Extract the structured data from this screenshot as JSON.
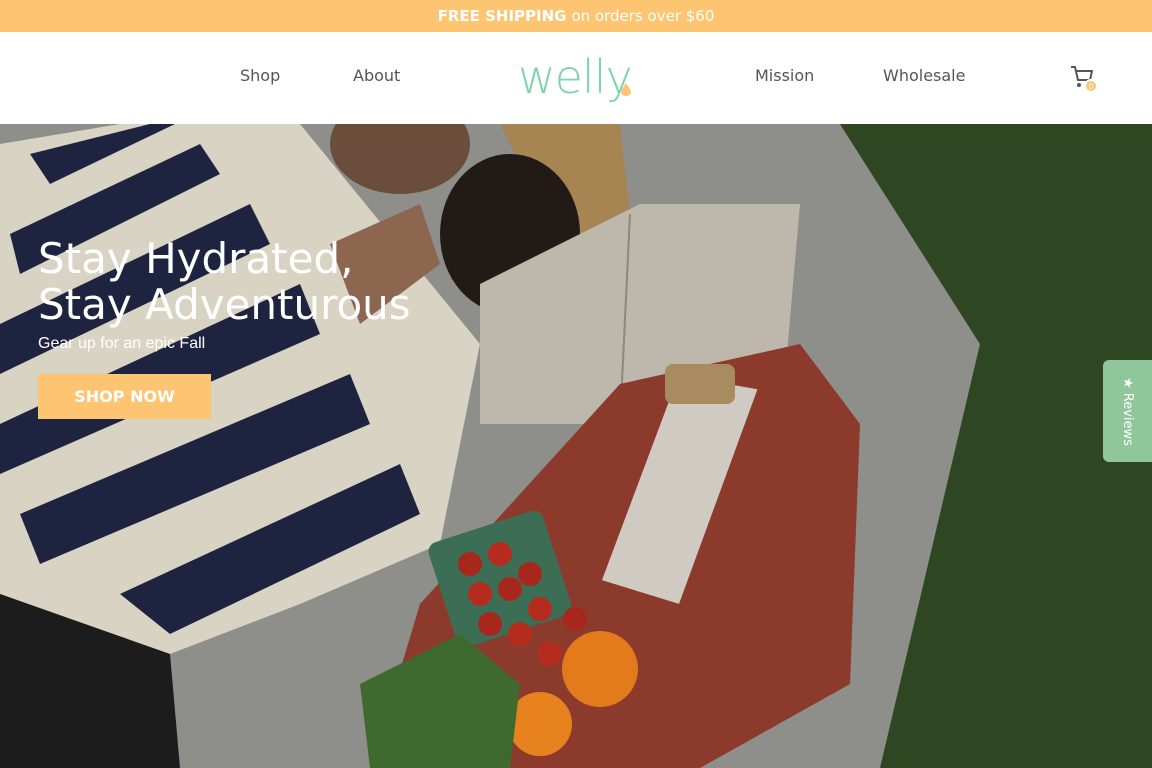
{
  "promo": {
    "bold": "FREE SHIPPING",
    "rest": "on orders over $60"
  },
  "nav": {
    "shop": "Shop",
    "about": "About",
    "mission": "Mission",
    "wholesale": "Wholesale"
  },
  "logo": {
    "text": "welly"
  },
  "cart": {
    "icon": "cart-icon",
    "count": "0"
  },
  "hero": {
    "title": "Stay Hydrated, Stay Adventurous",
    "subtitle": "Gear up for an epic Fall",
    "cta": "SHOP NOW"
  },
  "reviews": {
    "label": "Reviews",
    "icon": "star-icon"
  },
  "colors": {
    "accent": "#fdc471",
    "brand": "#7fd3ad",
    "reviews": "#8fc79a"
  }
}
